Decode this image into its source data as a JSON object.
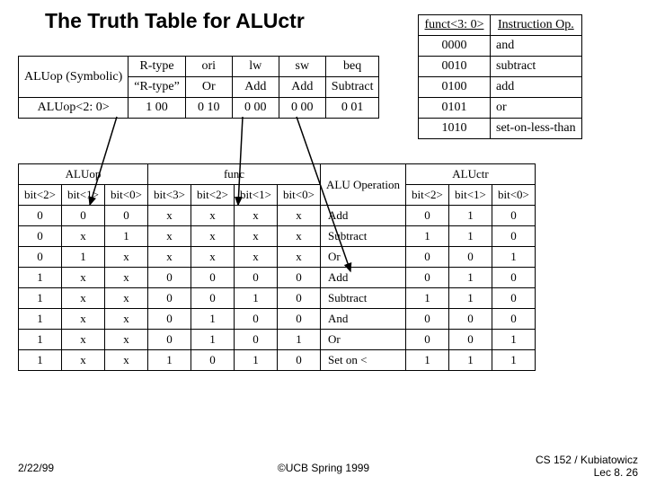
{
  "title": "The Truth Table for ALUctr",
  "table1": {
    "rowLabels": [
      "ALUop (Symbolic)",
      "ALUop<2: 0>"
    ],
    "cols": [
      "R-type",
      "ori",
      "lw",
      "sw",
      "beq"
    ],
    "r2": [
      "“R-type”",
      "Or",
      "Add",
      "Add",
      "Subtract"
    ],
    "r3": [
      "1 00",
      "0 10",
      "0 00",
      "0 00",
      "0 01"
    ]
  },
  "table2": {
    "hdr": [
      "funct<3: 0>",
      "Instruction Op."
    ],
    "rows": [
      [
        "0000",
        "and"
      ],
      [
        "0010",
        "subtract"
      ],
      [
        "0100",
        "add"
      ],
      [
        "0101",
        "or"
      ],
      [
        "1010",
        "set-on-less-than"
      ]
    ]
  },
  "table3": {
    "group_hdr": [
      "ALUop",
      "func",
      "ALU Operation",
      "ALUctr"
    ],
    "sub_hdr": [
      "bit<2>",
      "bit<1>",
      "bit<0>",
      "bit<3>",
      "bit<2>",
      "bit<1>",
      "bit<0>",
      "",
      "bit<2>",
      "bit<1>",
      "bit<0>"
    ],
    "rows": [
      [
        "0",
        "0",
        "0",
        "x",
        "x",
        "x",
        "x",
        "Add",
        "0",
        "1",
        "0"
      ],
      [
        "0",
        "x",
        "1",
        "x",
        "x",
        "x",
        "x",
        "Subtract",
        "1",
        "1",
        "0"
      ],
      [
        "0",
        "1",
        "x",
        "x",
        "x",
        "x",
        "x",
        "Or",
        "0",
        "0",
        "1"
      ],
      [
        "1",
        "x",
        "x",
        "0",
        "0",
        "0",
        "0",
        "Add",
        "0",
        "1",
        "0"
      ],
      [
        "1",
        "x",
        "x",
        "0",
        "0",
        "1",
        "0",
        "Subtract",
        "1",
        "1",
        "0"
      ],
      [
        "1",
        "x",
        "x",
        "0",
        "1",
        "0",
        "0",
        "And",
        "0",
        "0",
        "0"
      ],
      [
        "1",
        "x",
        "x",
        "0",
        "1",
        "0",
        "1",
        "Or",
        "0",
        "0",
        "1"
      ],
      [
        "1",
        "x",
        "x",
        "1",
        "0",
        "1",
        "0",
        "Set on <",
        "1",
        "1",
        "1"
      ]
    ]
  },
  "footer": {
    "date": "2/22/99",
    "center": "©UCB Spring 1999",
    "right_l1": "CS 152 / Kubiatowicz",
    "right_l2": "Lec 8. 26"
  }
}
